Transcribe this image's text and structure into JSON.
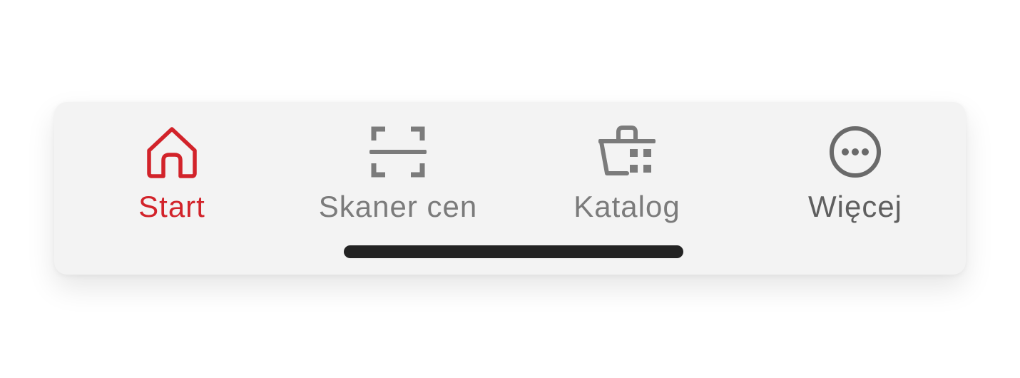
{
  "colors": {
    "accent": "#d2232a",
    "inactive": "#7b7b7b",
    "bar_background": "#f3f3f3",
    "home_indicator": "#232323"
  },
  "tabbar": {
    "tabs": [
      {
        "label": "Start",
        "icon": "home-icon",
        "active": true
      },
      {
        "label": "Skaner cen",
        "icon": "scanner-icon",
        "active": false
      },
      {
        "label": "Katalog",
        "icon": "basket-icon",
        "active": false
      },
      {
        "label": "Więcej",
        "icon": "more-icon",
        "active": false
      }
    ]
  }
}
